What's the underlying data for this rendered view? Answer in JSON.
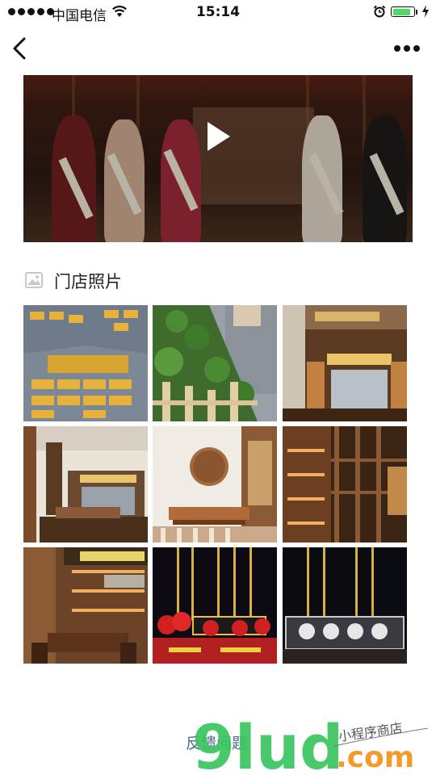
{
  "status_bar": {
    "carrier": "中国电信",
    "time": "15:14",
    "battery_level": 0.85
  },
  "nav": {
    "back_icon": "chevron-left-icon",
    "more_icon": "more-horizontal-icon"
  },
  "video": {
    "play_icon": "play-icon"
  },
  "store_photos": {
    "icon": "image-icon",
    "title": "门店照片",
    "photo_count": 9
  },
  "feedback": {
    "label": "反馈问题"
  },
  "watermark": {
    "logo_text": "9lud",
    "suffix": ".com",
    "tagline": "小程序商店"
  },
  "colors": {
    "link": "#4d6a8a",
    "battery": "#4cd964",
    "logo_green": "#39c35f",
    "logo_orange": "#f39a2c"
  }
}
